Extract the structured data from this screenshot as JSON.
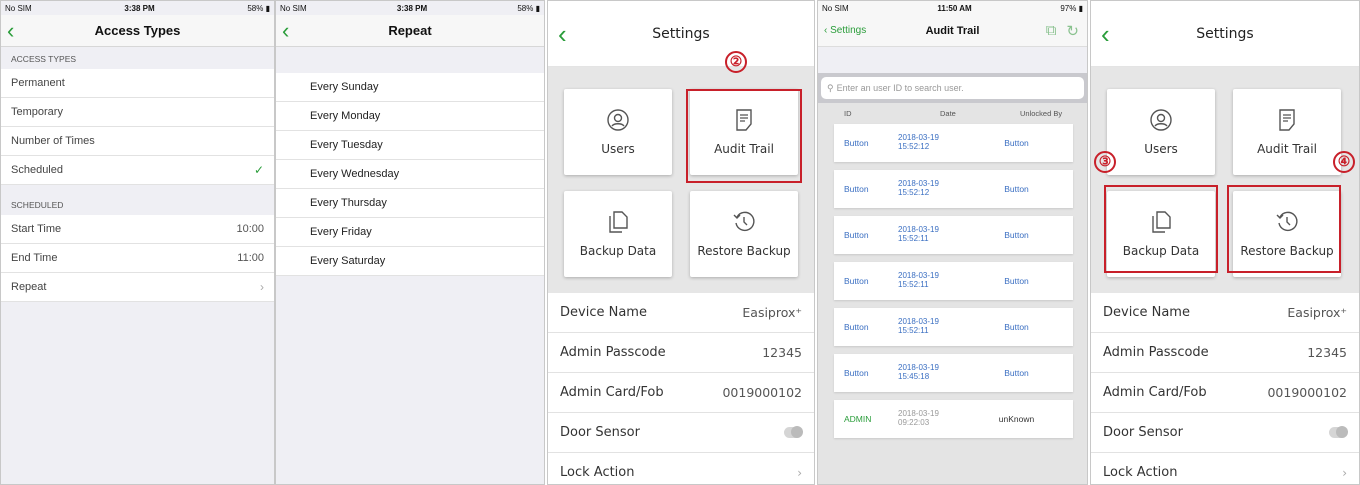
{
  "status_bars": [
    {
      "carrier": "No SIM",
      "time": "3:38 PM",
      "right": "58%"
    },
    {
      "carrier": "No SIM",
      "time": "3:38 PM",
      "right": "58%"
    },
    {
      "carrier": "No SIM",
      "time": "11:50 AM",
      "right": "97%"
    }
  ],
  "access": {
    "title": "Access Types",
    "section1": "ACCESS TYPES",
    "types": [
      "Permanent",
      "Temporary",
      "Number of Times",
      "Scheduled"
    ],
    "selected": "Scheduled",
    "section2": "SCHEDULED",
    "start_label": "Start Time",
    "start_value": "10:00",
    "end_label": "End Time",
    "end_value": "11:00",
    "repeat_label": "Repeat"
  },
  "repeat": {
    "title": "Repeat",
    "days": [
      "Every Sunday",
      "Every Monday",
      "Every Tuesday",
      "Every Wednesday",
      "Every Thursday",
      "Every Friday",
      "Every Saturday"
    ]
  },
  "settings": {
    "title": "Settings",
    "tiles": {
      "users": "Users",
      "audit": "Audit Trail",
      "backup": "Backup Data",
      "restore": "Restore Backup"
    },
    "rows": {
      "device_name": "Device Name",
      "device_value": "Easiprox⁺",
      "admin_pass": "Admin Passcode",
      "admin_pass_value": "12345",
      "admin_card": "Admin Card/Fob",
      "admin_card_value": "0019000102",
      "door_sensor": "Door Sensor",
      "lock_action": "Lock Action"
    }
  },
  "audit": {
    "back": "Settings",
    "title": "Audit Trail",
    "search_placeholder": "Enter an user ID to search user.",
    "columns": [
      "ID",
      "Date",
      "Unlocked By"
    ],
    "rows": [
      {
        "id": "Button",
        "date": "2018-03-19",
        "time": "15:52:12",
        "by": "Button"
      },
      {
        "id": "Button",
        "date": "2018-03-19",
        "time": "15:52:12",
        "by": "Button"
      },
      {
        "id": "Button",
        "date": "2018-03-19",
        "time": "15:52:11",
        "by": "Button"
      },
      {
        "id": "Button",
        "date": "2018-03-19",
        "time": "15:52:11",
        "by": "Button"
      },
      {
        "id": "Button",
        "date": "2018-03-19",
        "time": "15:52:11",
        "by": "Button"
      },
      {
        "id": "Button",
        "date": "2018-03-19",
        "time": "15:45:18",
        "by": "Button"
      },
      {
        "id": "ADMIN",
        "date": "2018-03-19",
        "time": "09:22:03",
        "by": "unKnown"
      }
    ]
  },
  "callouts": [
    "②",
    "③",
    "④"
  ],
  "colors": {
    "accent": "#2a9d3a",
    "highlight": "#c8202a",
    "link": "#3b6fc2"
  }
}
